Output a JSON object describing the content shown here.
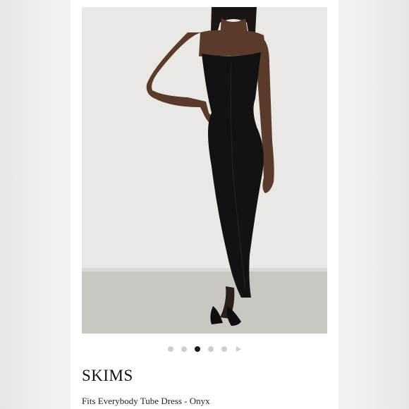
{
  "listing": {
    "brand": "SKIMS",
    "product_name": "Fits Everybody Tube Dress - Onyx"
  },
  "gallery": {
    "image_label": "product-photo",
    "slide_count": 5,
    "active_index": 2,
    "next_icon": "chevron-right-icon"
  },
  "colors": {
    "dot_inactive": "#cfcfcf",
    "dot_active": "#1a1a1a",
    "dress": "#121212"
  }
}
